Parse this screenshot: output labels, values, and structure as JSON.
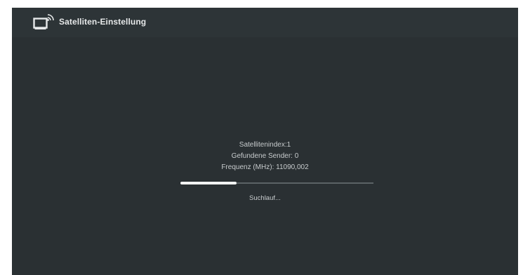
{
  "header": {
    "icon": "satellite-tv-icon",
    "title": "Satelliten-Einstellung"
  },
  "scan": {
    "satellite_index": "Satellitenindex:1",
    "found_channels": "Gefundene Sender: 0",
    "frequency": "Frequenz (MHz): 11090,002",
    "progress": 0.29,
    "status_text": "Suchlauf..."
  },
  "colors": {
    "background": "#2a3033",
    "header_background": "#2d3437",
    "text": "#c7cbcd",
    "progress_fill": "#f2f3f3",
    "progress_track": "#5b6266"
  }
}
